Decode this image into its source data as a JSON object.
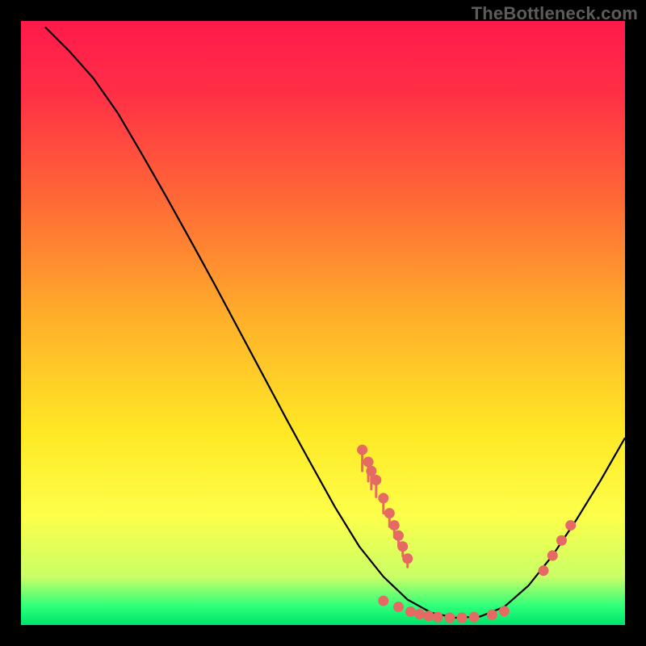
{
  "watermark": "TheBottleneck.com",
  "chart_data": {
    "type": "line",
    "title": "",
    "xlabel": "",
    "ylabel": "",
    "xlim": [
      0,
      100
    ],
    "ylim": [
      0,
      100
    ],
    "gradient_stops": [
      {
        "offset": 0,
        "color": "#ff1a4b"
      },
      {
        "offset": 12,
        "color": "#ff2f46"
      },
      {
        "offset": 30,
        "color": "#ff6a36"
      },
      {
        "offset": 50,
        "color": "#ffb22a"
      },
      {
        "offset": 68,
        "color": "#ffe825"
      },
      {
        "offset": 82,
        "color": "#fdff4a"
      },
      {
        "offset": 92,
        "color": "#c9ff66"
      },
      {
        "offset": 97,
        "color": "#2bff7a"
      },
      {
        "offset": 100,
        "color": "#00e46a"
      }
    ],
    "curve": [
      {
        "x": 4.0,
        "y": 99.0
      },
      {
        "x": 8.0,
        "y": 95.0
      },
      {
        "x": 12.0,
        "y": 90.5
      },
      {
        "x": 16.0,
        "y": 84.8
      },
      {
        "x": 20.0,
        "y": 78.0
      },
      {
        "x": 24.0,
        "y": 71.0
      },
      {
        "x": 28.0,
        "y": 63.8
      },
      {
        "x": 32.0,
        "y": 56.5
      },
      {
        "x": 36.0,
        "y": 49.0
      },
      {
        "x": 40.0,
        "y": 41.5
      },
      {
        "x": 44.0,
        "y": 34.0
      },
      {
        "x": 48.0,
        "y": 26.7
      },
      {
        "x": 52.0,
        "y": 19.5
      },
      {
        "x": 56.0,
        "y": 13.0
      },
      {
        "x": 60.0,
        "y": 8.0
      },
      {
        "x": 64.0,
        "y": 4.2
      },
      {
        "x": 68.0,
        "y": 2.0
      },
      {
        "x": 72.0,
        "y": 1.2
      },
      {
        "x": 76.0,
        "y": 1.4
      },
      {
        "x": 80.0,
        "y": 3.0
      },
      {
        "x": 84.0,
        "y": 6.5
      },
      {
        "x": 88.0,
        "y": 11.5
      },
      {
        "x": 92.0,
        "y": 17.5
      },
      {
        "x": 96.0,
        "y": 24.0
      },
      {
        "x": 100.0,
        "y": 31.0
      }
    ],
    "points": [
      {
        "x": 56.5,
        "y": 29.0
      },
      {
        "x": 57.5,
        "y": 27.0
      },
      {
        "x": 58.0,
        "y": 25.5
      },
      {
        "x": 58.8,
        "y": 24.0
      },
      {
        "x": 60.0,
        "y": 21.0
      },
      {
        "x": 61.0,
        "y": 18.5
      },
      {
        "x": 61.8,
        "y": 16.5
      },
      {
        "x": 62.5,
        "y": 14.8
      },
      {
        "x": 63.2,
        "y": 13.0
      },
      {
        "x": 64.0,
        "y": 11.0
      },
      {
        "x": 60.0,
        "y": 4.0
      },
      {
        "x": 62.5,
        "y": 3.0
      },
      {
        "x": 64.5,
        "y": 2.2
      },
      {
        "x": 66.0,
        "y": 1.8
      },
      {
        "x": 67.5,
        "y": 1.5
      },
      {
        "x": 69.0,
        "y": 1.3
      },
      {
        "x": 71.0,
        "y": 1.2
      },
      {
        "x": 73.0,
        "y": 1.2
      },
      {
        "x": 75.0,
        "y": 1.3
      },
      {
        "x": 78.0,
        "y": 1.7
      },
      {
        "x": 80.0,
        "y": 2.3
      },
      {
        "x": 86.5,
        "y": 9.0
      },
      {
        "x": 88.0,
        "y": 11.5
      },
      {
        "x": 89.5,
        "y": 14.0
      },
      {
        "x": 91.0,
        "y": 16.5
      }
    ],
    "point_tails": [
      {
        "x": 56.5,
        "y1": 29.0,
        "y2": 25.5
      },
      {
        "x": 57.5,
        "y1": 27.0,
        "y2": 23.8
      },
      {
        "x": 58.0,
        "y1": 25.5,
        "y2": 22.5
      },
      {
        "x": 58.8,
        "y1": 24.0,
        "y2": 21.2
      },
      {
        "x": 60.0,
        "y1": 21.0,
        "y2": 18.5
      },
      {
        "x": 61.0,
        "y1": 18.5,
        "y2": 16.3
      },
      {
        "x": 61.8,
        "y1": 16.5,
        "y2": 14.5
      },
      {
        "x": 62.5,
        "y1": 14.8,
        "y2": 13.0
      },
      {
        "x": 63.2,
        "y1": 13.0,
        "y2": 11.4
      },
      {
        "x": 64.0,
        "y1": 11.0,
        "y2": 9.6
      }
    ]
  }
}
